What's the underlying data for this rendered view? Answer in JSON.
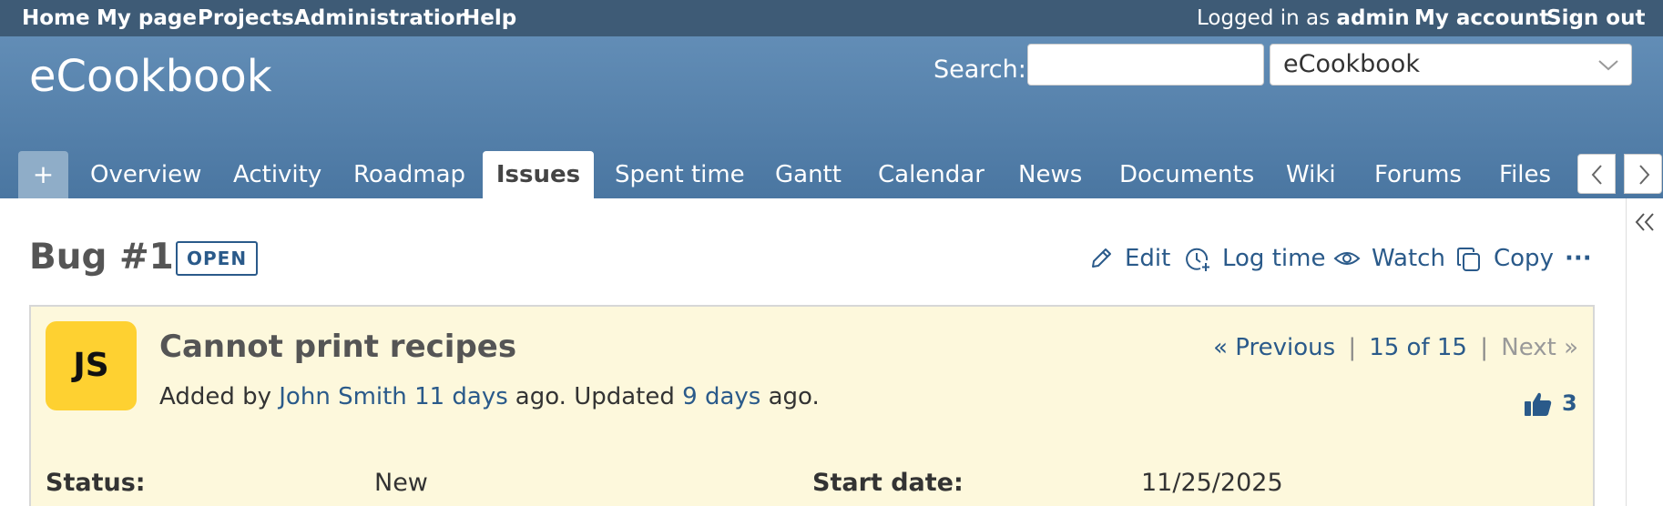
{
  "top_menu": {
    "left_links": [
      "Home",
      "My page",
      "Projects",
      "Administration",
      "Help"
    ],
    "logged_in_prefix": "Logged in as",
    "logged_in_user": "admin",
    "my_account": "My account",
    "sign_out": "Sign out"
  },
  "header": {
    "project_title": "eCookbook",
    "search_label": "Search:",
    "search_value": "",
    "project_select_value": "eCookbook"
  },
  "tabs": {
    "new": "+",
    "items": [
      "Overview",
      "Activity",
      "Roadmap",
      "Issues",
      "Spent time",
      "Gantt",
      "Calendar",
      "News",
      "Documents",
      "Wiki",
      "Forums",
      "Files"
    ],
    "selected": "Issues"
  },
  "issue": {
    "heading": "Bug #1",
    "status_badge": "OPEN",
    "actions": {
      "edit": "Edit",
      "log_time": "Log time",
      "watch": "Watch",
      "copy": "Copy",
      "more": "···"
    },
    "avatar_initials": "JS",
    "subject": "Cannot print recipes",
    "added_by_prefix": "Added by",
    "author": "John Smith",
    "added_ago": "11 days",
    "ago_updated": "ago. Updated",
    "updated_ago": "9 days",
    "ago_end": "ago.",
    "nav": {
      "previous": "« Previous",
      "sep1": "|",
      "position": "15 of 15",
      "sep2": "|",
      "next": "Next »"
    },
    "votes": "3",
    "attributes": {
      "status_label": "Status:",
      "status_value": "New",
      "start_date_label": "Start date:",
      "start_date_value": "11/25/2025"
    }
  },
  "colors": {
    "top_menu_bg": "#3e5b76",
    "header_bg": "#628db6",
    "link": "#2a5a8a",
    "issue_bg": "#fdf8dc",
    "avatar_bg": "#fed131"
  }
}
